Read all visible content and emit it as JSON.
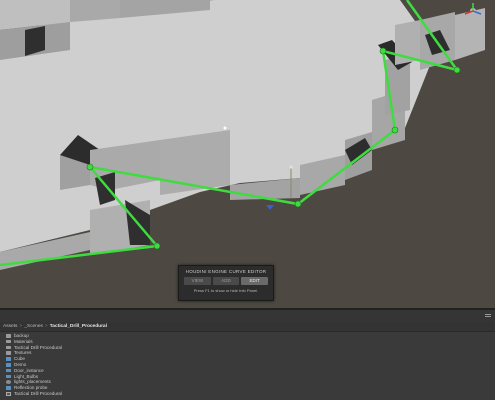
{
  "curve_editor": {
    "title": "HOUDINI ENGINE CURVE EDITOR",
    "buttons": [
      "VIEW",
      "ADD",
      "EDIT"
    ],
    "active_button": "EDIT",
    "hint": "Press F1 to show or hide Info Panel."
  },
  "project": {
    "breadcrumb": [
      "Assets",
      "_Scenes",
      "Tactical_Drill_Procedural"
    ],
    "items": [
      {
        "label": "backup",
        "icon": "folder-icon"
      },
      {
        "label": "Materials",
        "icon": "folder-icon"
      },
      {
        "label": "Tactical Drill Procedural",
        "icon": "folder-icon"
      },
      {
        "label": "Textures",
        "icon": "folder-icon"
      },
      {
        "label": "Cube",
        "icon": "prefab-icon"
      },
      {
        "label": "Demo",
        "icon": "prefab-icon"
      },
      {
        "label": "Door_instance",
        "icon": "prefab-icon"
      },
      {
        "label": "Light_Bulbs",
        "icon": "prefab-icon"
      },
      {
        "label": "lights_placements",
        "icon": "asset-icon"
      },
      {
        "label": "Reflection probe",
        "icon": "prefab-icon"
      },
      {
        "label": "Tactical Drill Procedural",
        "icon": "scene-icon"
      }
    ]
  },
  "colors": {
    "curve": "#3fdc3f",
    "floor": "#cfcfcf",
    "ground": "#4d4842",
    "wall_face": "#a9a9a9",
    "wall_dark": "#2f2f2f"
  }
}
